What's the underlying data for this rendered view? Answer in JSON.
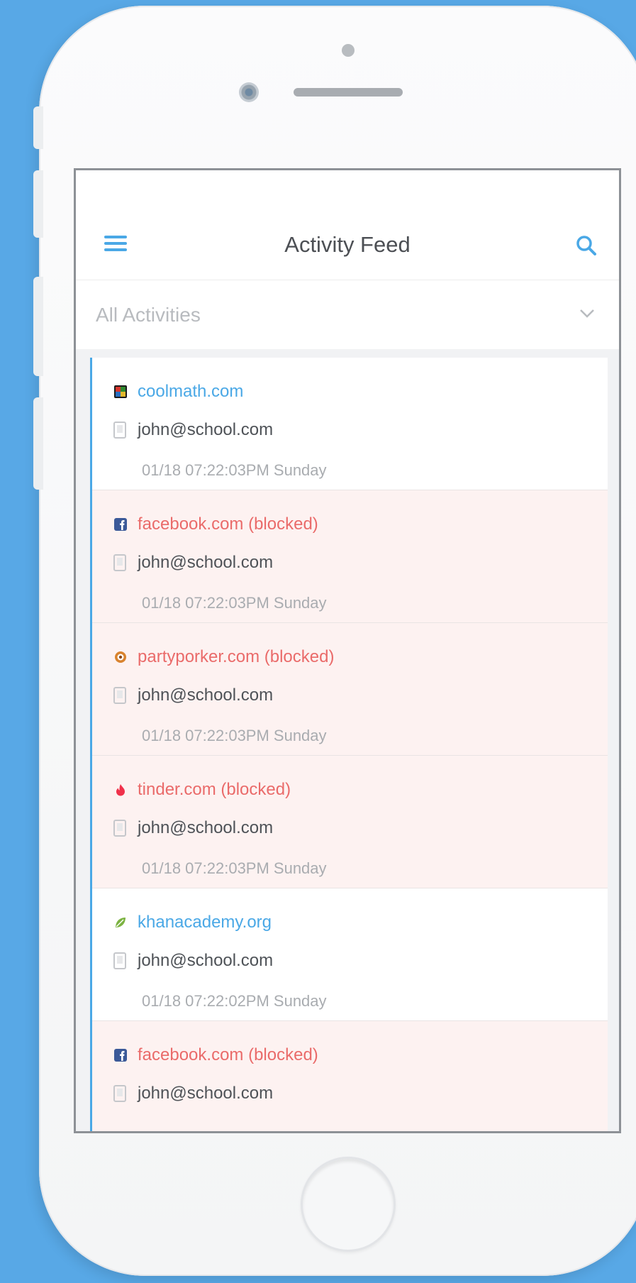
{
  "header": {
    "title": "Activity Feed",
    "menu_icon": "hamburger-menu-icon",
    "search_icon": "search-icon"
  },
  "filter": {
    "selected": "All Activities",
    "icon": "chevron-down-icon"
  },
  "colors": {
    "accent": "#4aa8e6",
    "blocked_text": "#ea6b6a",
    "blocked_background": "#fdf2f1",
    "background": "#58a8e6"
  },
  "feed": {
    "items": [
      {
        "site": "coolmath.com",
        "status": "allowed",
        "icon": "coolmath-favicon-icon",
        "user": "john@school.com",
        "time": "01/18 07:22:03PM Sunday"
      },
      {
        "site": "facebook.com (blocked)",
        "status": "blocked",
        "icon": "facebook-favicon-icon",
        "user": "john@school.com",
        "time": "01/18 07:22:03PM Sunday"
      },
      {
        "site": "partyporker.com (blocked)",
        "status": "blocked",
        "icon": "partyporker-favicon-icon",
        "user": "john@school.com",
        "time": "01/18 07:22:03PM Sunday"
      },
      {
        "site": "tinder.com (blocked)",
        "status": "blocked",
        "icon": "tinder-favicon-icon",
        "user": "john@school.com",
        "time": "01/18 07:22:03PM Sunday"
      },
      {
        "site": "khanacademy.org",
        "status": "allowed",
        "icon": "khanacademy-favicon-icon",
        "user": "john@school.com",
        "time": "01/18 07:22:02PM Sunday"
      },
      {
        "site": "facebook.com (blocked)",
        "status": "blocked",
        "icon": "facebook-favicon-icon",
        "user": "john@school.com",
        "time": ""
      }
    ]
  }
}
